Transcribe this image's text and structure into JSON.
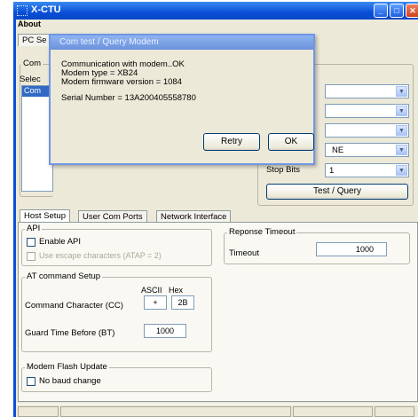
{
  "window": {
    "title": "X-CTU",
    "minimize_glyph": "_",
    "maximize_glyph": "□",
    "close_glyph": "✕"
  },
  "menu": {
    "about": "About"
  },
  "tabs_top": {
    "pc_settings": "PC Se"
  },
  "left_panel": {
    "com_group_label": "Com",
    "select_label": "Selec",
    "selected_port": "Com"
  },
  "dialog": {
    "title": "Com test / Query Modem",
    "lines": [
      "Communication with modem..OK",
      "Modem type = XB24",
      "Modem firmware version = 1084"
    ],
    "serial": "Serial Number = 13A200405558780",
    "retry_label": "Retry",
    "ok_label": "OK"
  },
  "serial_settings": {
    "parity_value": "NE",
    "stop_bits_label": "Stop Bits",
    "stop_bits_value": "1",
    "test_query_label": "Test / Query"
  },
  "lower_tabs": [
    "Host Setup",
    "User Com Ports",
    "Network Interface"
  ],
  "api": {
    "group_label": "API",
    "enable_api_label": "Enable API",
    "escape_label": "Use escape characters (ATAP = 2)"
  },
  "at_setup": {
    "group_label": "AT command Setup",
    "ascii_header": "ASCII",
    "hex_header": "Hex",
    "command_char_label": "Command Character (CC)",
    "command_char_ascii": "+",
    "command_char_hex": "2B",
    "guard_time_label": "Guard Time Before (BT)",
    "guard_time_value": "1000"
  },
  "modem_flash": {
    "group_label": "Modem Flash Update",
    "no_baud_label": "No baud change"
  },
  "response_timeout": {
    "group_label": "Reponse Timeout",
    "timeout_label": "Timeout",
    "timeout_value": "1000"
  },
  "icons": {
    "arrow": "▼",
    "scroll_arrow": "▾"
  }
}
